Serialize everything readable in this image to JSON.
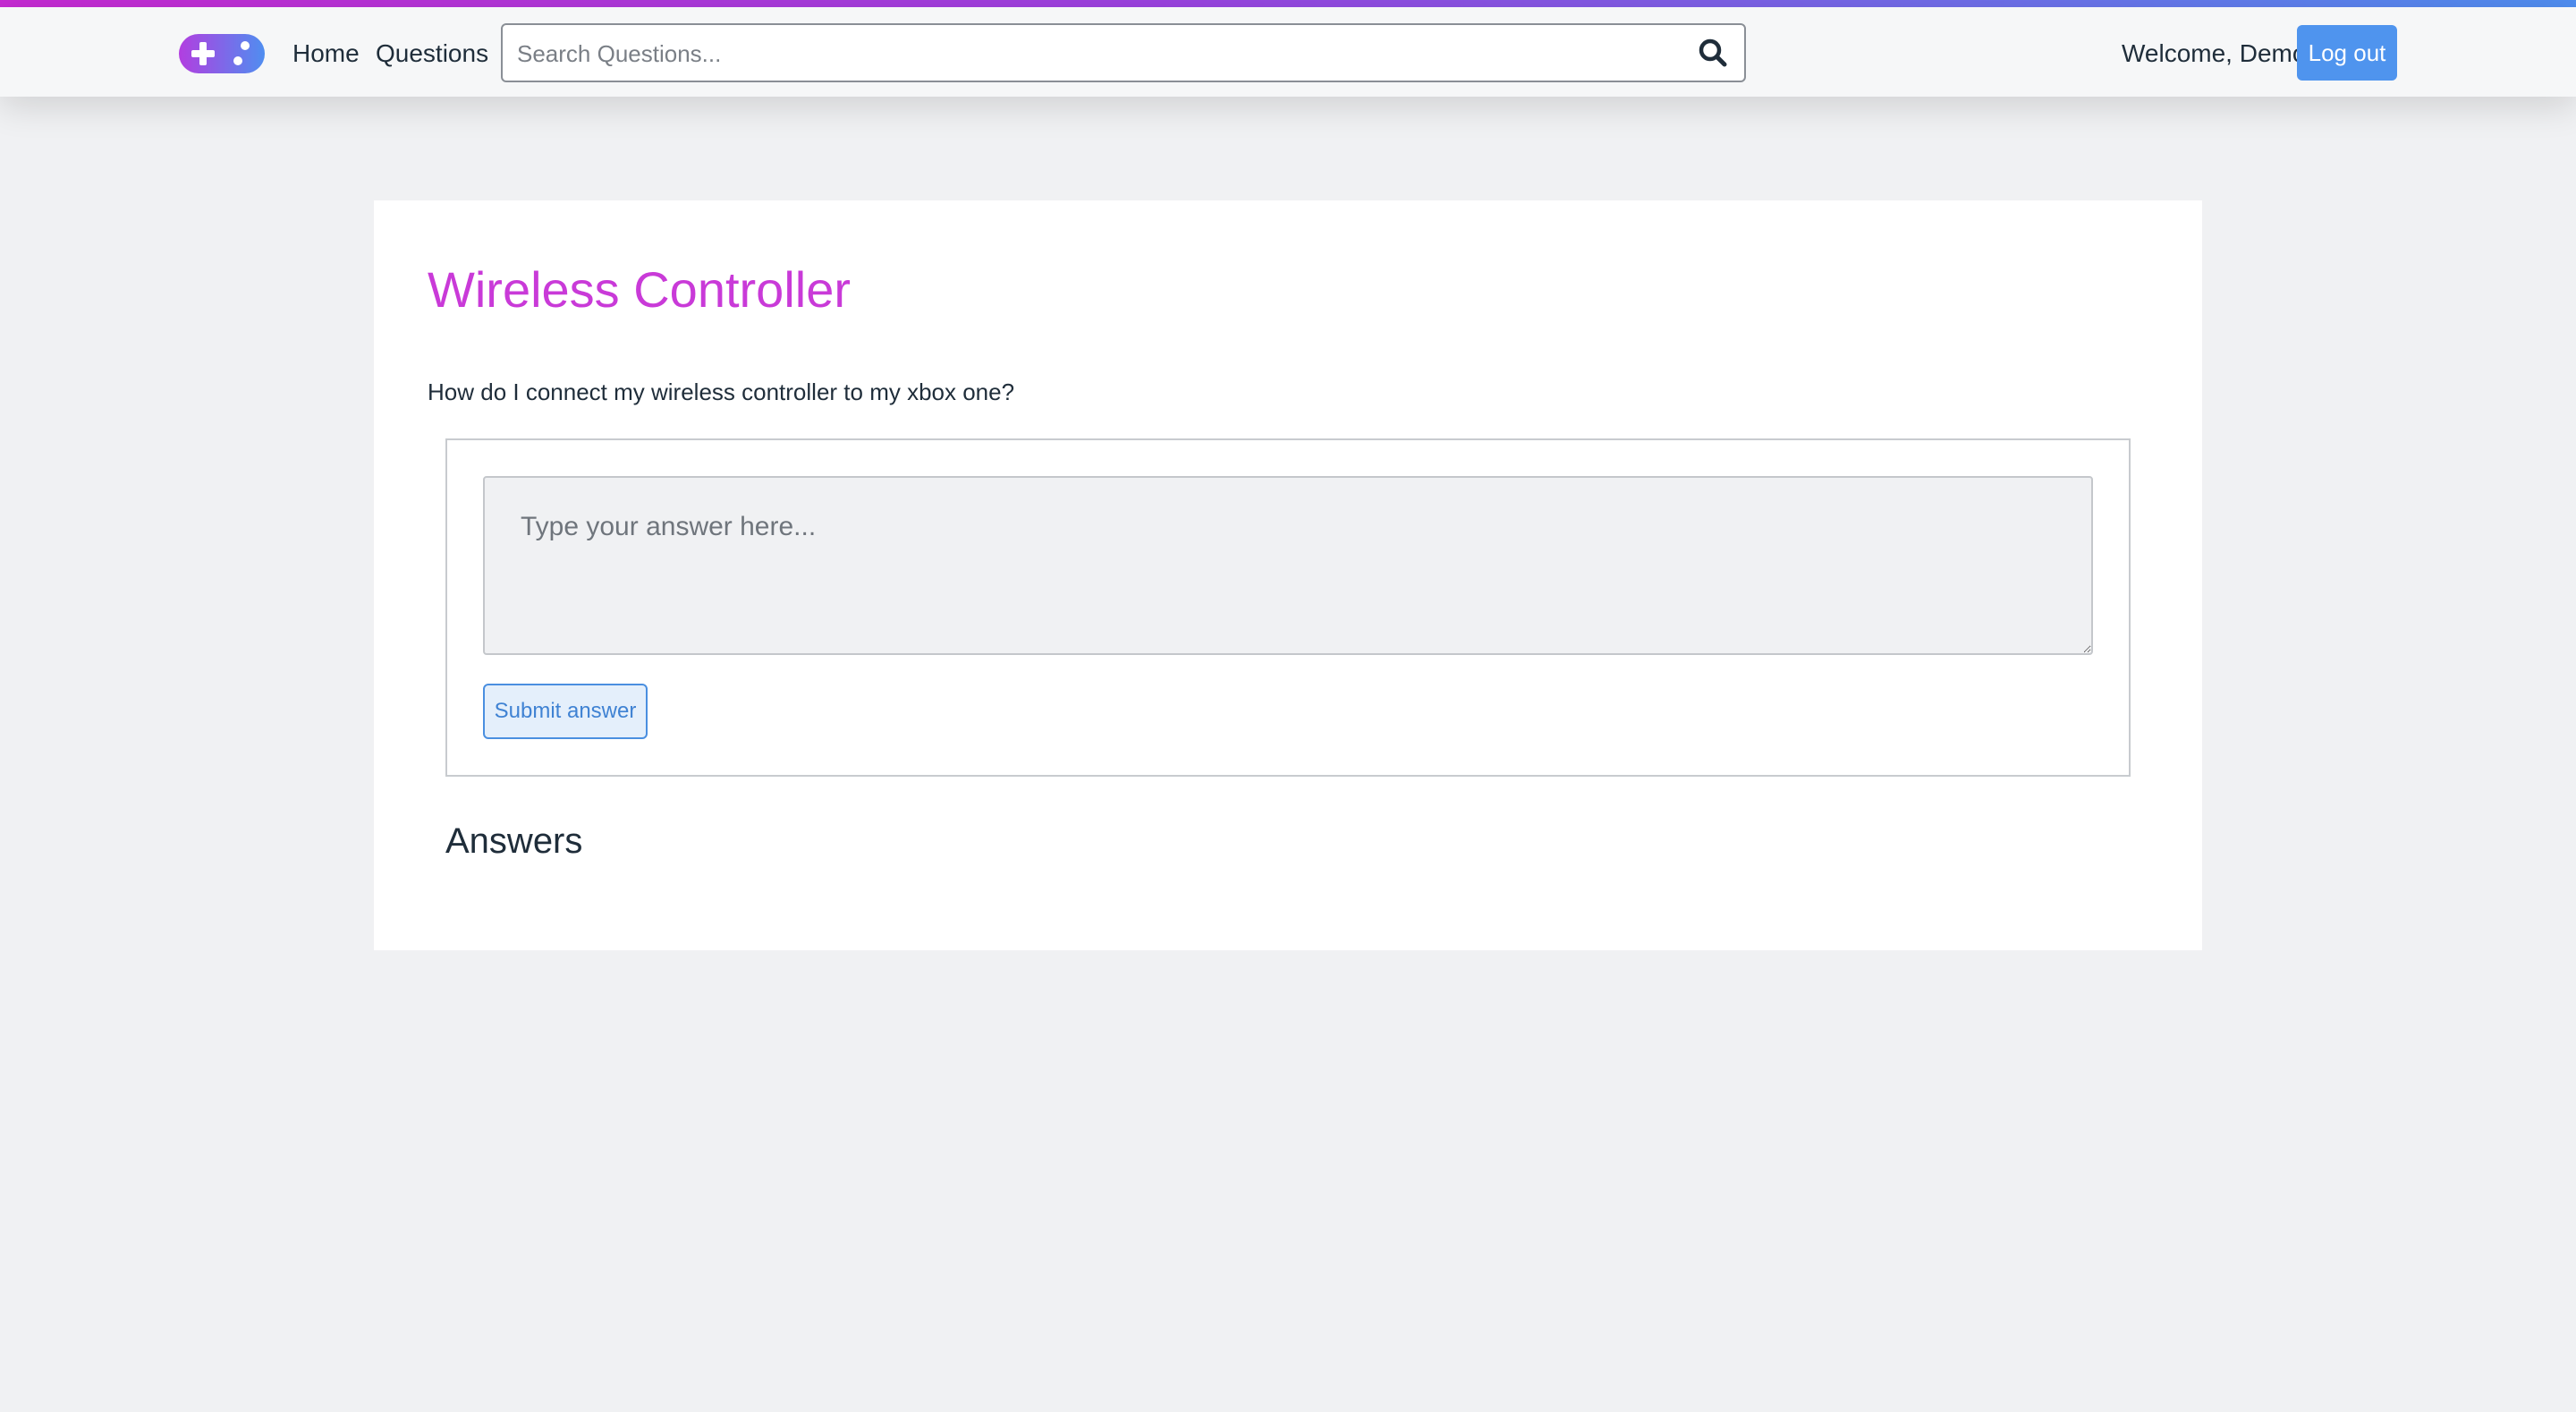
{
  "header": {
    "logo_icon": "gamepad-icon",
    "nav": [
      {
        "label": "Home"
      },
      {
        "label": "Questions"
      }
    ],
    "search": {
      "placeholder": "Search Questions...",
      "value": "",
      "icon": "search-icon"
    },
    "welcome": "Welcome, Demo!",
    "logout_label": "Log out"
  },
  "question": {
    "title": "Wireless Controller",
    "body": "How do I connect my wireless controller to my xbox one?"
  },
  "answer_form": {
    "placeholder": "Type your answer here...",
    "value": "",
    "submit_label": "Submit answer"
  },
  "answers": {
    "heading": "Answers",
    "items": []
  },
  "colors": {
    "brand_pink": "#c93ad8",
    "brand_purple": "#9b42e0",
    "accent_blue": "#4f94ee",
    "page_bg": "#f0f1f3"
  }
}
